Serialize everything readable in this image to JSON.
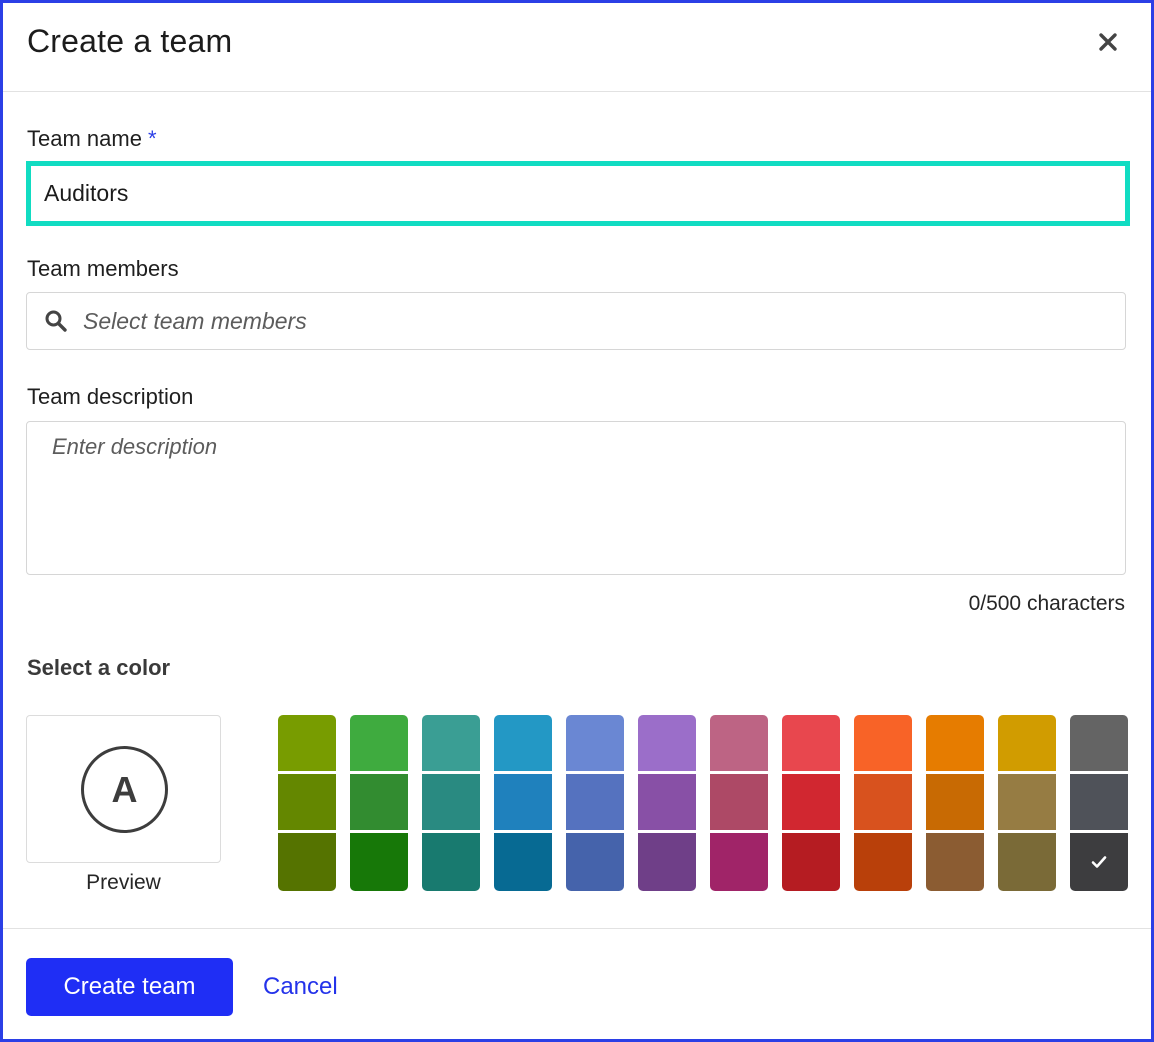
{
  "dialog": {
    "title": "Create a team",
    "close_icon": "close-icon"
  },
  "team_name": {
    "label": "Team name",
    "required_mark": "*",
    "value": "Auditors",
    "focus_color": "#11dcc2"
  },
  "team_members": {
    "label": "Team members",
    "placeholder": "Select team members",
    "icon": "search-icon"
  },
  "team_description": {
    "label": "Team description",
    "placeholder": "Enter description",
    "char_count": "0/500 characters"
  },
  "color_picker": {
    "label": "Select a color",
    "preview_letter": "A",
    "preview_label": "Preview",
    "selected": {
      "column": 11,
      "row": 2
    },
    "columns": [
      [
        "#789c00",
        "#648700",
        "#557300"
      ],
      [
        "#3fab3f",
        "#328c30",
        "#177808"
      ],
      [
        "#3a9e94",
        "#298a81",
        "#187a6f"
      ],
      [
        "#2398c5",
        "#1f81bd",
        "#076a93"
      ],
      [
        "#6a87d3",
        "#5572bf",
        "#4563ab"
      ],
      [
        "#9b6ec9",
        "#8850a6",
        "#6f3f88"
      ],
      [
        "#bd6484",
        "#ad4966",
        "#a02468"
      ],
      [
        "#e8474e",
        "#d12730",
        "#b51c22"
      ],
      [
        "#f86327",
        "#d8521e",
        "#b9400a"
      ],
      [
        "#e67c00",
        "#c86a03",
        "#8b5c32"
      ],
      [
        "#d19c00",
        "#967c43",
        "#7a6a37"
      ],
      [
        "#646464",
        "#4f5259",
        "#3d3d3f"
      ]
    ]
  },
  "footer": {
    "create_label": "Create team",
    "cancel_label": "Cancel",
    "primary_color": "#1f2ef5"
  }
}
